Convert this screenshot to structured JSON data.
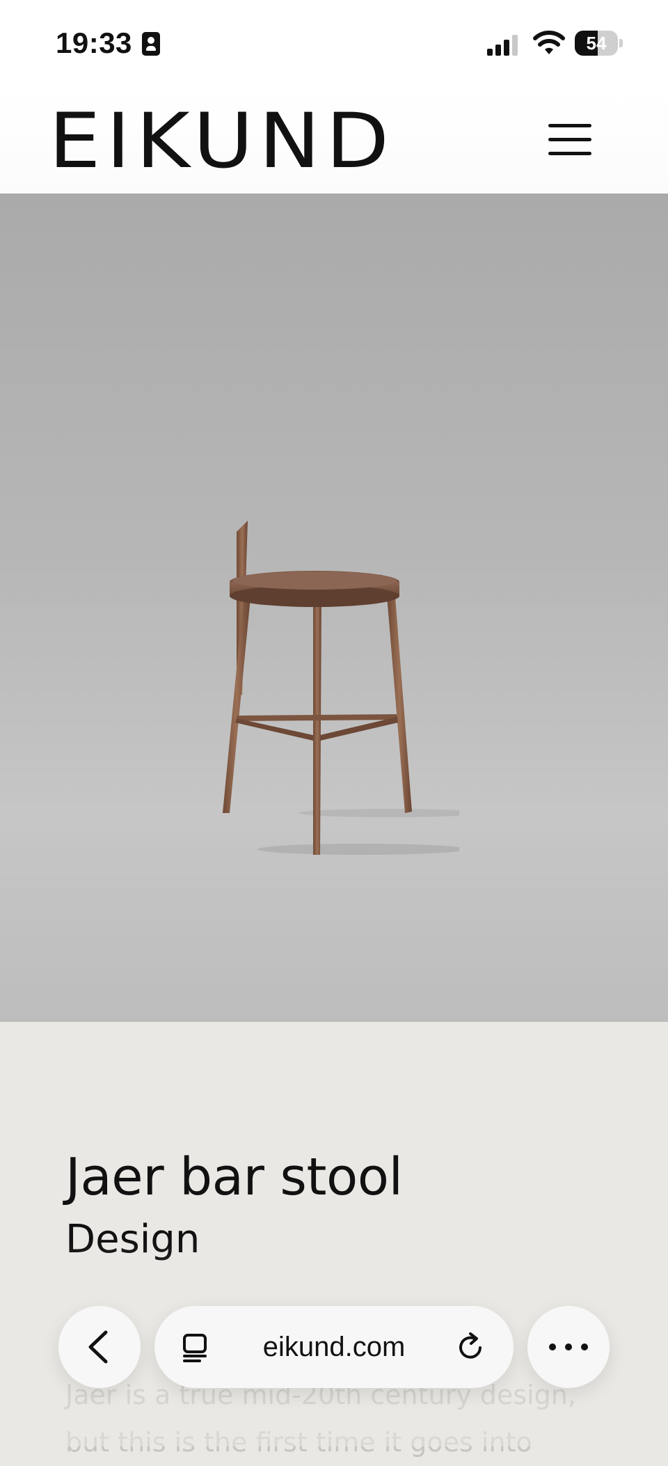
{
  "status_bar": {
    "time": "19:33",
    "battery_level": "54",
    "battery_fraction": 0.54
  },
  "header": {
    "logo": "EIKUND",
    "menu_icon": "hamburger-menu-icon"
  },
  "hero": {
    "image_subject": "stool-image"
  },
  "content": {
    "title": "Jaer bar stool",
    "section": "Design",
    "description": "Jaer is a true mid-20th century design, but this is the first time it goes into"
  },
  "browser": {
    "url": "eikund.com",
    "icons": [
      "back-icon",
      "tabs-icon",
      "reload-icon",
      "more-icon"
    ]
  },
  "colors": {
    "background": "#eae8e4",
    "hero_gray": "#b7b7b7",
    "text": "#111111",
    "faded_text": "#c6c5c2",
    "wood": "#8c6248"
  }
}
